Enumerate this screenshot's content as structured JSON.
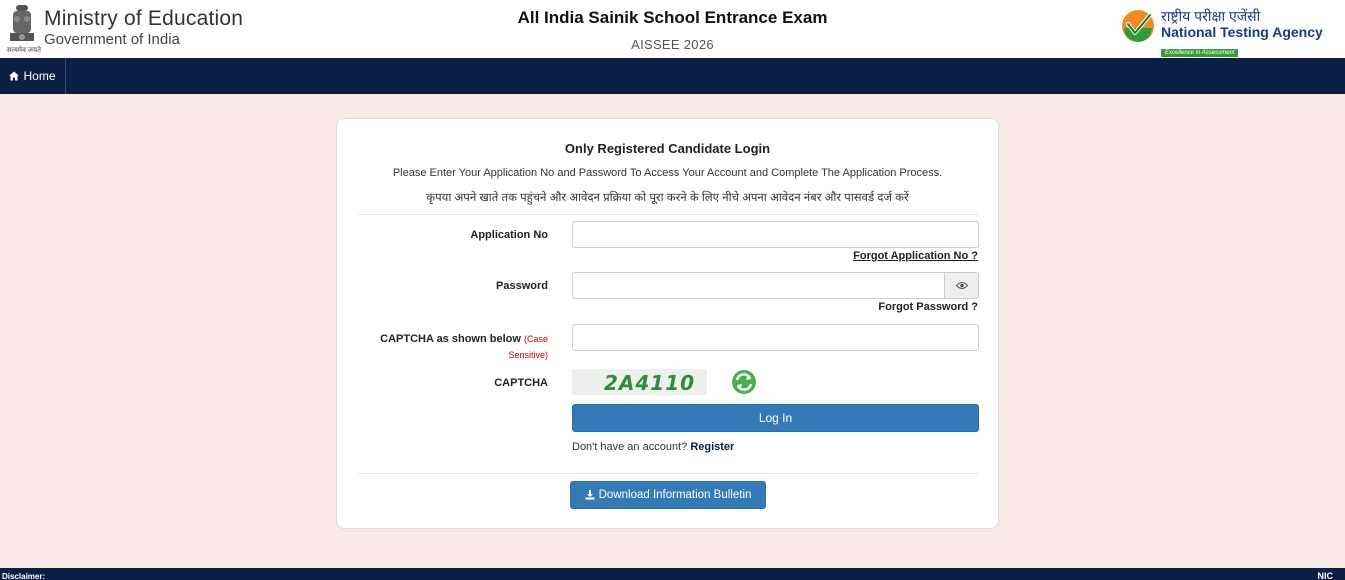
{
  "header": {
    "ministry_title": "Ministry of Education",
    "ministry_subtitle": "Government of India",
    "emblem_motto": "सत्यमेव जयते",
    "exam_title": "All India Sainik School Entrance Exam",
    "exam_code": "AISSEE 2026",
    "nta_hindi": "राष्ट्रीय परीक्षा एजेंसी",
    "nta_english": "National Testing Agency",
    "nta_tagline": "Excellence in Assessment"
  },
  "nav": {
    "home_label": "Home"
  },
  "login": {
    "title": "Only Registered Candidate Login",
    "instruction_en": "Please Enter Your Application No and Password To Access Your Account and Complete The Application Process.",
    "instruction_hi": "कृपया अपने खाते तक पहुंचने और आवेदन प्रक्रिया को पूरा करने के लिए नीचे अपना आवेदन नंबर और पासवर्ड दर्ज करें",
    "application_no_label": "Application No",
    "application_no_value": "",
    "forgot_application_label": "Forgot Application No ?",
    "password_label": "Password",
    "password_value": "",
    "forgot_password_label": "Forgot Password ?",
    "captcha_input_label": "CAPTCHA as shown below",
    "case_sensitive_label": "(Case Sensitive)",
    "captcha_input_value": "",
    "captcha_label": "CAPTCHA",
    "captcha_text": "2A4110",
    "login_button": "Log In",
    "no_account_text": "Don't have an account?",
    "register_link": "Register",
    "download_bulletin_button": "Download Information Bulletin"
  },
  "footer": {
    "disclaimer_label": "Disclaimer:",
    "nic_label": "NIC"
  },
  "colors": {
    "navbar": "#0b1f45",
    "page_background": "#fbeaea",
    "primary_button": "#337ab7",
    "case_sensitive_red": "#cc0000",
    "captcha_green": "#2e8b3a"
  }
}
